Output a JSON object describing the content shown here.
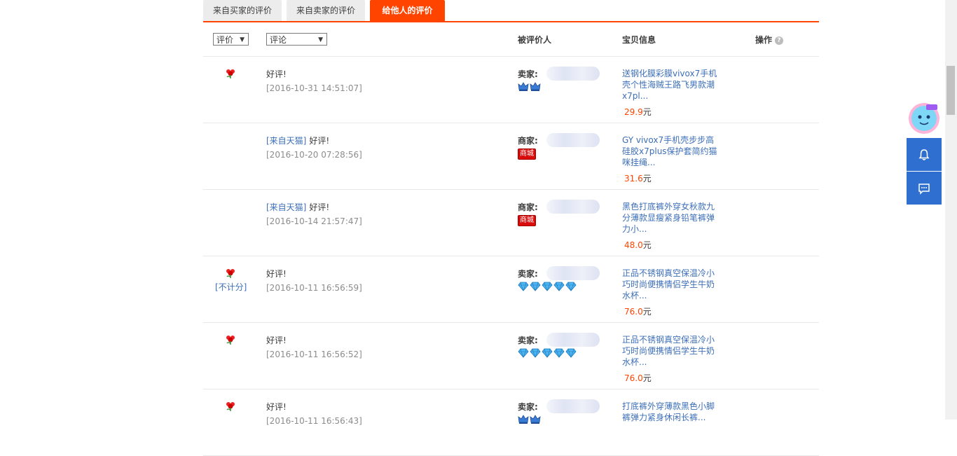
{
  "tabs": [
    {
      "label": "来自买家的评价",
      "active": false
    },
    {
      "label": "来自卖家的评价",
      "active": false
    },
    {
      "label": "给他人的评价",
      "active": true
    }
  ],
  "header": {
    "rating_select": "评价",
    "comment_select": "评论",
    "col_target": "被评价人",
    "col_item": "宝贝信息",
    "col_action": "操作",
    "help_icon": "?"
  },
  "rows": [
    {
      "tmall": "",
      "text": "好评!",
      "date": "[2016-10-31 14:51:07]",
      "who": "卖家:",
      "badge": "crown",
      "badge_count": 2,
      "item": "送钢化膜彩膜vivox7手机壳个性海贼王路飞男款潮x7pl...",
      "price": "29.9",
      "unit": "元",
      "flower": true,
      "note": ""
    },
    {
      "tmall": "[来自天猫]",
      "text": "好评!",
      "date": "[2016-10-20 07:28:56]",
      "who": "商家:",
      "badge": "mall",
      "badge_count": 1,
      "item": "GY vivox7手机壳步步高硅胶x7plus保护套简约猫咪挂绳...",
      "price": "31.6",
      "unit": "元",
      "flower": false,
      "note": ""
    },
    {
      "tmall": "[来自天猫]",
      "text": "好评!",
      "date": "[2016-10-14 21:57:47]",
      "who": "商家:",
      "badge": "mall",
      "badge_count": 1,
      "item": "黑色打底裤外穿女秋款九分薄款显瘦紧身铅笔裤弹力小...",
      "price": "48.0",
      "unit": "元",
      "flower": false,
      "note": ""
    },
    {
      "tmall": "",
      "text": "好评!",
      "date": "[2016-10-11 16:56:59]",
      "who": "卖家:",
      "badge": "diamond",
      "badge_count": 5,
      "item": "正品不锈钢真空保温冷小巧时尚便携情侣学生牛奶水杯...",
      "price": "76.0",
      "unit": "元",
      "flower": true,
      "note": "[不计分]"
    },
    {
      "tmall": "",
      "text": "好评!",
      "date": "[2016-10-11 16:56:52]",
      "who": "卖家:",
      "badge": "diamond",
      "badge_count": 5,
      "item": "正品不锈钢真空保温冷小巧时尚便携情侣学生牛奶水杯...",
      "price": "76.0",
      "unit": "元",
      "flower": true,
      "note": ""
    },
    {
      "tmall": "",
      "text": "好评!",
      "date": "[2016-10-11 16:56:43]",
      "who": "卖家:",
      "badge": "crown",
      "badge_count": 2,
      "item": "打底裤外穿薄款黑色小脚裤弹力紧身休闲长裤...",
      "price": "",
      "unit": "",
      "flower": true,
      "note": ""
    }
  ],
  "icons": {
    "flower": "red-flower-icon",
    "crown": "blue-crown-icon",
    "diamond": "blue-diamond-icon",
    "bell": "bell-icon",
    "chat": "chat-icon",
    "mascot": "mascot-icon"
  },
  "colors": {
    "accent": "#ff4400",
    "link": "#3d6fb8",
    "float_bg": "#2f6fcf",
    "mall_badge": "#d90b0b"
  }
}
